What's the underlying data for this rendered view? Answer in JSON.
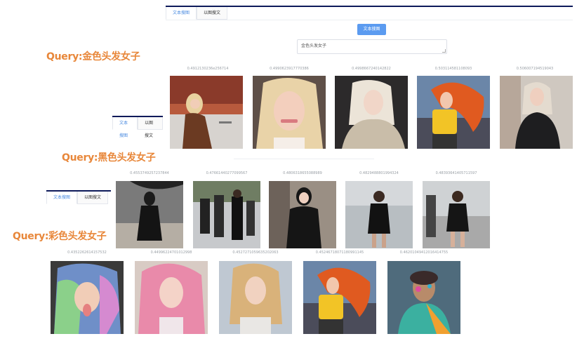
{
  "panels": [
    {
      "tabs": [
        "文本搜图",
        "以图搜文"
      ],
      "active_tab": 0
    },
    {
      "tabs": [
        "文本搜图",
        "以图搜文"
      ],
      "active_tab": 0
    },
    {
      "tabs": [
        "文本搜图",
        "以图搜文"
      ],
      "active_tab": 0
    }
  ],
  "search": {
    "button_label": "文本搜图",
    "input_value": "金色头发女子"
  },
  "queries": [
    {
      "label": "Query:金色头发女子",
      "scores": [
        "0.4912130236e256714",
        "0.4990623917770386",
        "0.4998667240142822",
        "0.503114581108093",
        "0.506007194519043"
      ],
      "images": [
        "blonde-woman-brown-coat",
        "blonde-woman-selfie",
        "blonde-woman-beige-sweater",
        "red-haired-woman-yellow-top",
        "blonde-woman-black-coat-phone"
      ]
    },
    {
      "label": "Query:黑色头发女子",
      "scores": [
        "0.4553749257237844",
        "0.47661440277099567",
        "0.4806318655088989",
        "0.4829488801994324",
        "0.48393641405711597"
      ],
      "images": [
        "woman-black-dress-umbrella",
        "street-crowd-black-outfits",
        "woman-black-leather-sitting",
        "woman-black-dress-street",
        "woman-black-dress-walking"
      ]
    },
    {
      "label": "Query:彩色头发女子",
      "scores": [
        "0.4352262614157532",
        "0.44996224701012998",
        "0.4527271059635202063",
        "0.45246718071180991145",
        "0.46201049412016414755"
      ],
      "images": [
        "rainbow-hair-woman",
        "pink-hair-woman",
        "ombre-hair-woman",
        "red-haired-woman-yellow-top",
        "painted-woman-colorful-costume"
      ]
    }
  ],
  "colors": {
    "accent": "#4a8be0",
    "query_label": "#e8873a",
    "button": "#5b9bf0",
    "topbar": "#0d1a5a"
  }
}
